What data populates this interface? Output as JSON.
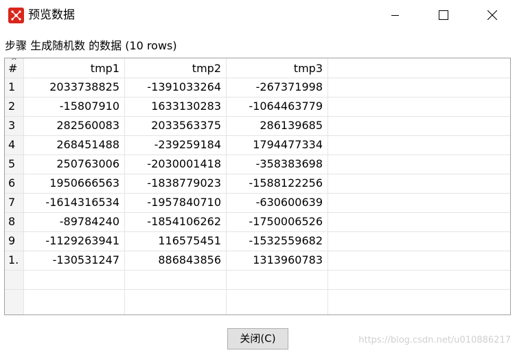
{
  "window": {
    "title": "预览数据",
    "icon": "app-logo-icon",
    "controls": [
      "minimize-icon",
      "maximize-icon",
      "close-icon"
    ]
  },
  "subtitle": "步骤 生成随机数 的数据 (10 rows)",
  "table": {
    "sort_indicator": "^",
    "columns": [
      "#",
      "tmp1",
      "tmp2",
      "tmp3"
    ],
    "rows": [
      [
        "1",
        "2033738825",
        "-1391033264",
        "-267371998"
      ],
      [
        "2",
        "-15807910",
        "1633130283",
        "-1064463779"
      ],
      [
        "3",
        "282560083",
        "2033563375",
        "286139685"
      ],
      [
        "4",
        "268451488",
        "-239259184",
        "1794477334"
      ],
      [
        "5",
        "250763006",
        "-2030001418",
        "-358383698"
      ],
      [
        "6",
        "1950666563",
        "-1838779023",
        "-1588122256"
      ],
      [
        "7",
        "-1614316534",
        "-1957840710",
        "-630600639"
      ],
      [
        "8",
        "-89784240",
        "-1854106262",
        "-1750006526"
      ],
      [
        "9",
        "-1129263941",
        "116575451",
        "-1532559682"
      ],
      [
        "1.",
        "-130531247",
        "886843856",
        "1313960783"
      ]
    ]
  },
  "buttons": {
    "close_label": "关闭(C)"
  },
  "watermark": "https://blog.csdn.net/u010886217",
  "colors": {
    "app_icon": "#d9261c",
    "grid_line": "#e4e4e4",
    "index_column_bg": "#f4f4f4",
    "button_bg": "#e1e1e1"
  }
}
